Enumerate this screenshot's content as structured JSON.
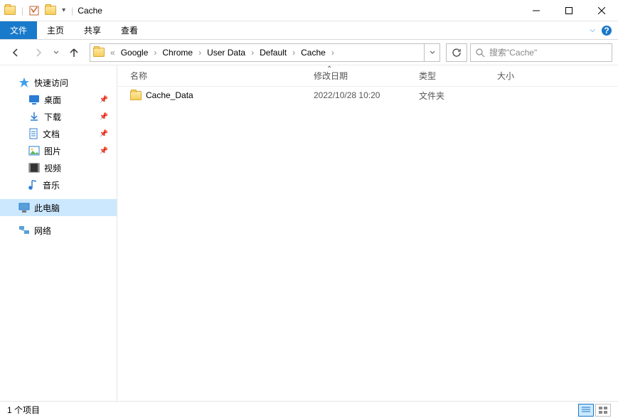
{
  "window": {
    "title": "Cache"
  },
  "ribbon": {
    "file": "文件",
    "home": "主页",
    "share": "共享",
    "view": "查看"
  },
  "breadcrumb": {
    "items": [
      "Google",
      "Chrome",
      "User Data",
      "Default",
      "Cache"
    ],
    "ellipsis": "«"
  },
  "search": {
    "placeholder": "搜索\"Cache\""
  },
  "sidebar": {
    "quick_access": "快速访问",
    "desktop": "桌面",
    "downloads": "下载",
    "documents": "文档",
    "pictures": "图片",
    "videos": "视频",
    "music": "音乐",
    "this_pc": "此电脑",
    "network": "网络"
  },
  "columns": {
    "name": "名称",
    "date": "修改日期",
    "type": "类型",
    "size": "大小"
  },
  "files": [
    {
      "name": "Cache_Data",
      "date": "2022/10/28 10:20",
      "type": "文件夹",
      "size": ""
    }
  ],
  "status": {
    "count": "1 个项目"
  }
}
